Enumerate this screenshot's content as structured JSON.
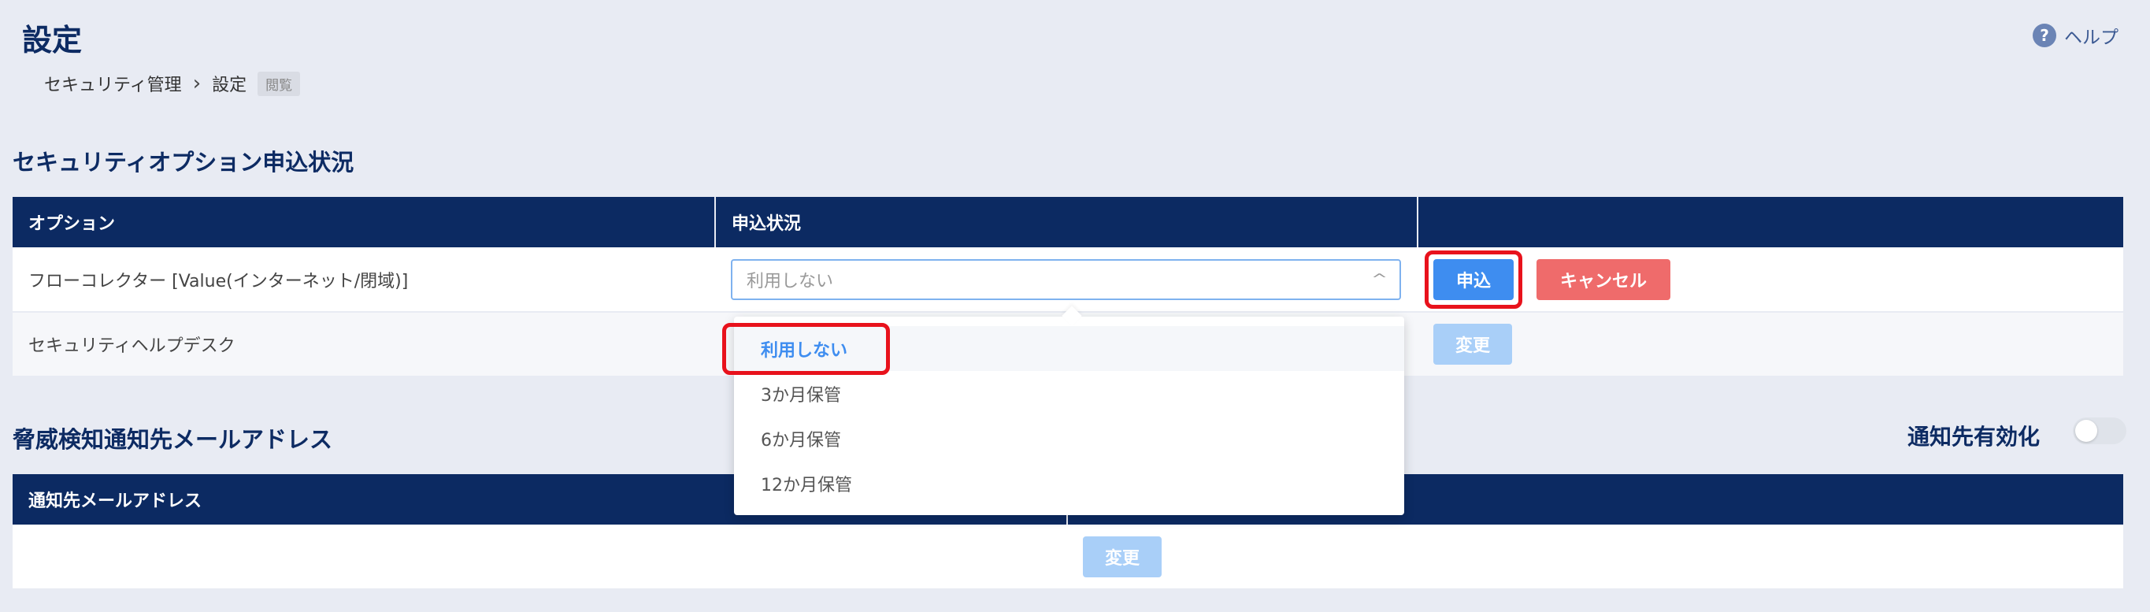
{
  "page": {
    "title": "設定",
    "help_label": "ヘルプ",
    "help_icon": "?"
  },
  "breadcrumb": {
    "items": [
      "セキュリティ管理",
      "設定"
    ],
    "separator": ">",
    "badge": "閲覧"
  },
  "options_section": {
    "title": "セキュリティオプション申込状況",
    "headers": [
      "オプション",
      "申込状況",
      ""
    ],
    "rows": [
      {
        "option": "フローコレクター [Value(インターネット/閉域)]",
        "status_placeholder": "利用しない",
        "apply_label": "申込",
        "cancel_label": "キャンセル"
      },
      {
        "option": "セキュリティヘルプデスク",
        "change_label": "変更"
      }
    ]
  },
  "dropdown": {
    "options": [
      "利用しない",
      "3か月保管",
      "6か月保管",
      "12か月保管"
    ],
    "selected": "利用しない"
  },
  "email_section": {
    "title": "脅威検知通知先メールアドレス",
    "toggle_label": "通知先有効化",
    "toggle_on": false,
    "headers": [
      "通知先メールアドレス",
      ""
    ],
    "change_label": "変更"
  },
  "colors": {
    "header_bg": "#0c2a62",
    "title": "#0d2b63",
    "primary": "#3e8df0",
    "danger": "#ef6b6b",
    "disabled_primary": "#a9cff8",
    "highlight": "#e8121c",
    "background": "#e8ebf3"
  }
}
